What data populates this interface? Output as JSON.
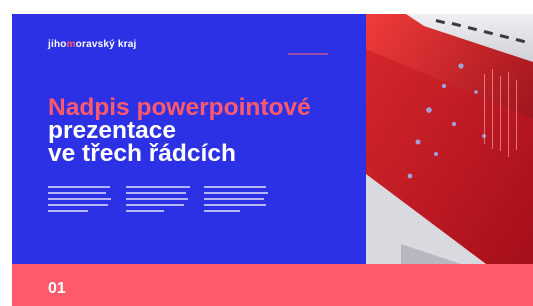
{
  "slide": {
    "logo": {
      "part1": "jiho",
      "part2": "m",
      "part3": "oravský kraj"
    },
    "top_link": "",
    "title": {
      "line1": "Nadpis powerpointové",
      "line2": "prezentace",
      "line3": "ve třech řádcích"
    },
    "number": "01"
  },
  "colors": {
    "blue_panel": "#2d31e6",
    "accent": "#ff5a6b",
    "photo_red": "#b80d16"
  },
  "icons": [
    "keyboard-photo"
  ]
}
